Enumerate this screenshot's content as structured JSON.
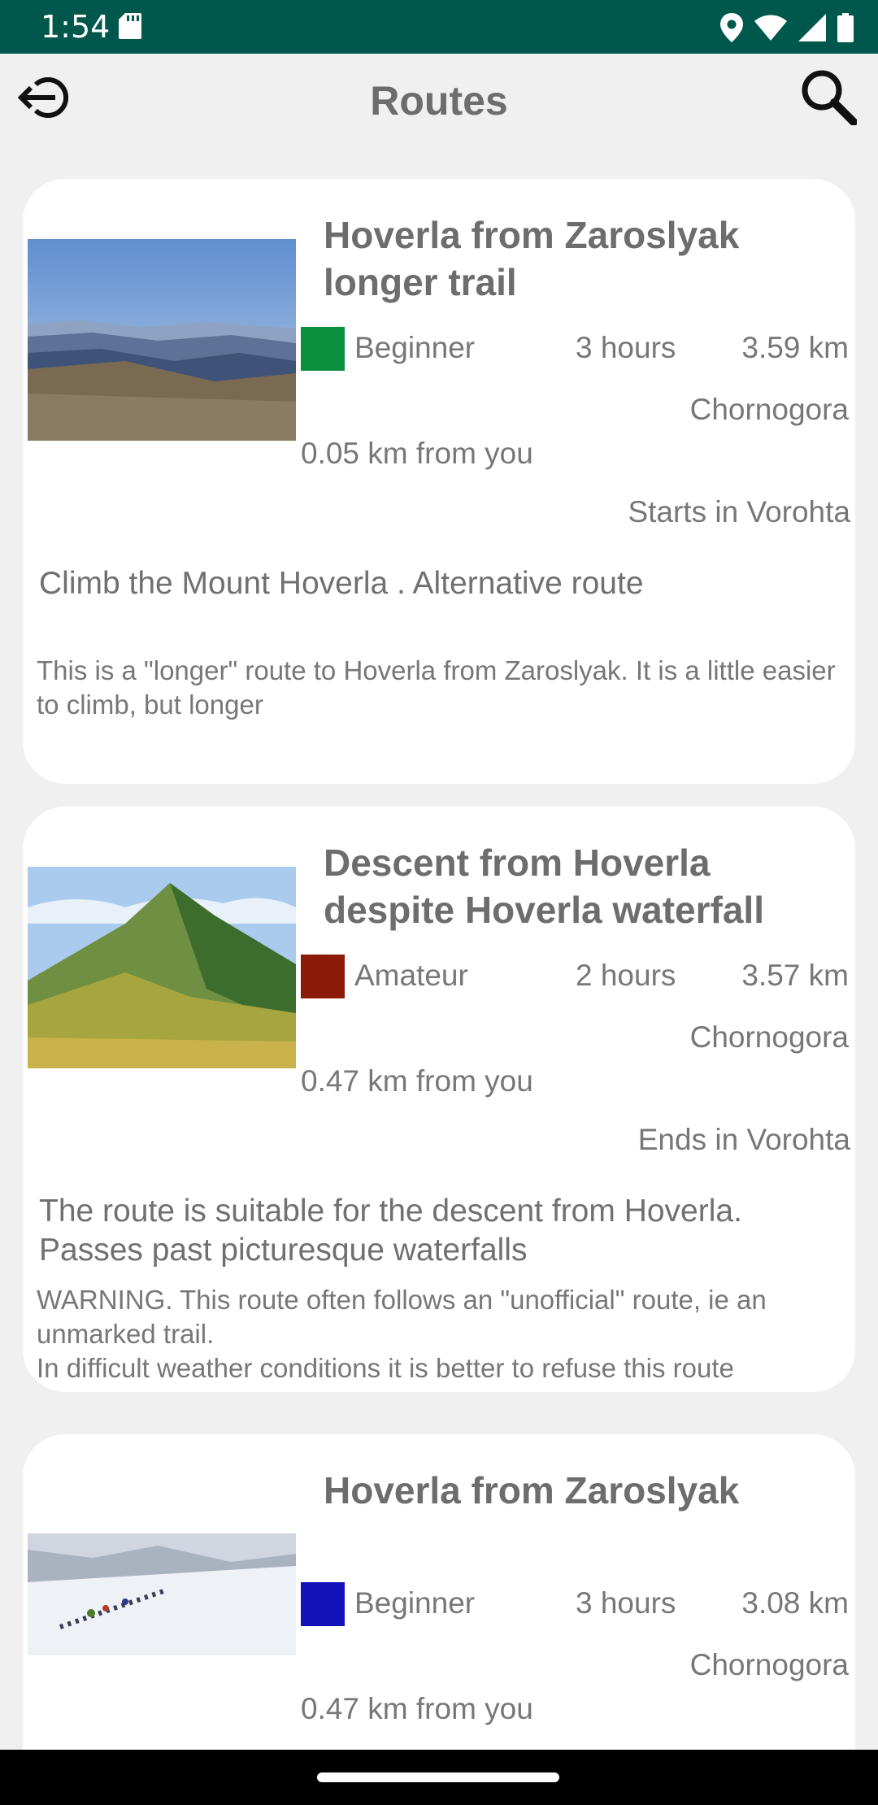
{
  "status_bar": {
    "time": "1:54",
    "icons": [
      "sd-card-icon",
      "location-icon",
      "wifi-icon",
      "signal-icon",
      "battery-icon"
    ]
  },
  "app_bar": {
    "title": "Routes",
    "back_icon": "logout-icon",
    "search_icon": "search-icon"
  },
  "colors": {
    "status_bar": "#00574b",
    "background": "#f0f0f0",
    "card": "#ffffff",
    "text": "#777777",
    "level_beginner_green": "#0a8f3e",
    "level_amateur": "#8b1a08",
    "level_beginner_blue": "#1212b8"
  },
  "routes": [
    {
      "title": "Hoverla from Zaroslyak longer trail",
      "level": "Beginner",
      "level_color": "#0a8f3e",
      "duration": "3 hours",
      "length": "3.59 km",
      "region": "Chornogora",
      "distance": "0.05 km from you",
      "start_end": "Starts in Vorohta",
      "summary": "Climb the Mount Hoverla . Alternative route",
      "description": "This is a \"longer\" route to Hoverla from Zaroslyak. It is a little easier to climb, but longer"
    },
    {
      "title": "Descent from Hoverla despite Hoverla waterfall",
      "level": "Amateur",
      "level_color": "#8b1a08",
      "duration": "2 hours",
      "length": "3.57 km",
      "region": "Chornogora",
      "distance": "0.47 km from you",
      "start_end": "Ends in Vorohta",
      "summary": "The route is suitable for the descent from Hoverla. Passes past picturesque waterfalls",
      "description": "WARNING. This route often follows an \"unofficial\" route, ie an unmarked trail.\nIn difficult weather conditions it is better to refuse this route"
    },
    {
      "title": "Hoverla from Zaroslyak",
      "level": "Beginner",
      "level_color": "#1212b8",
      "duration": "3 hours",
      "length": "3.08 km",
      "region": "Chornogora",
      "distance": "0.47 km from you"
    }
  ]
}
